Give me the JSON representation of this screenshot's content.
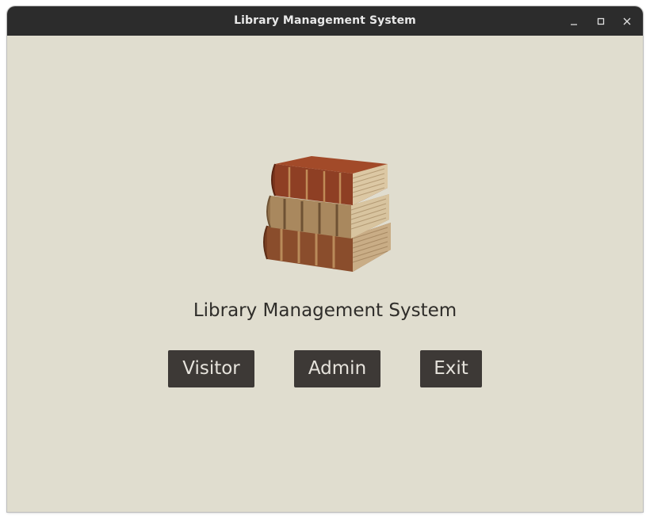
{
  "window": {
    "title": "Library Management System",
    "controls": {
      "minimize_icon": "minimize-icon",
      "maximize_icon": "maximize-icon",
      "close_icon": "close-icon"
    }
  },
  "main": {
    "logo_icon": "book-stack-icon",
    "title": "Library Management System",
    "buttons": {
      "visitor": "Visitor",
      "admin": "Admin",
      "exit": "Exit"
    }
  },
  "colors": {
    "titlebar": "#2c2c2c",
    "background": "#e0ddcf",
    "button": "#3d3936",
    "button_text": "#e6e3dc",
    "text": "#2f2d2a"
  }
}
